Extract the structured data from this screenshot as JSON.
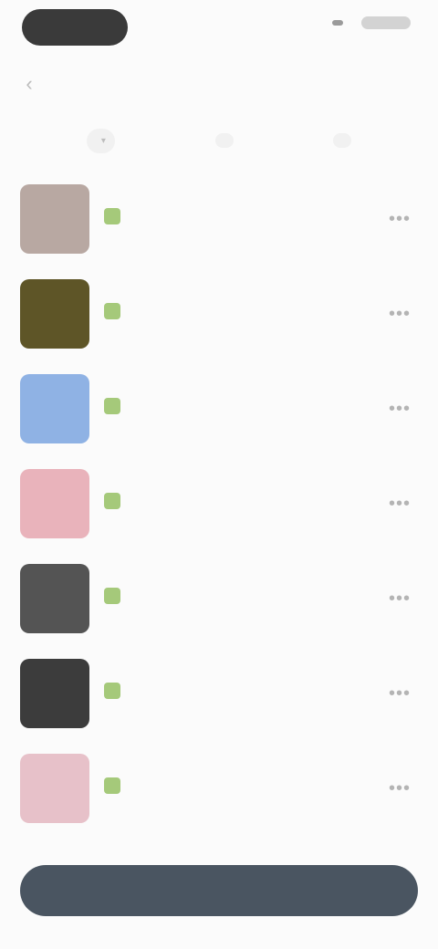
{
  "status_bar": {
    "left_label": "",
    "right_label": ""
  },
  "nav": {
    "title": ""
  },
  "filters": [
    {
      "label": ""
    },
    {
      "label": ""
    },
    {
      "label": ""
    }
  ],
  "items": [
    {
      "title": "",
      "subtitle": "",
      "thumb_color": "#b8a8a2"
    },
    {
      "title": "",
      "subtitle": "",
      "thumb_color": "#5e5527"
    },
    {
      "title": "",
      "subtitle": "",
      "thumb_color": "#8fb2e4"
    },
    {
      "title": "",
      "subtitle": "",
      "thumb_color": "#e9b3bb"
    },
    {
      "title": "",
      "subtitle": "",
      "thumb_color": "#545454"
    },
    {
      "title": "",
      "subtitle": "",
      "thumb_color": "#3c3c3c"
    },
    {
      "title": "",
      "subtitle": "",
      "thumb_color": "#e7c1c9"
    }
  ],
  "footer": {
    "note": "",
    "button_label": ""
  },
  "colors": {
    "accent": "#4a5561",
    "tag": "#a5c97a",
    "background": "#fbfbfb"
  }
}
